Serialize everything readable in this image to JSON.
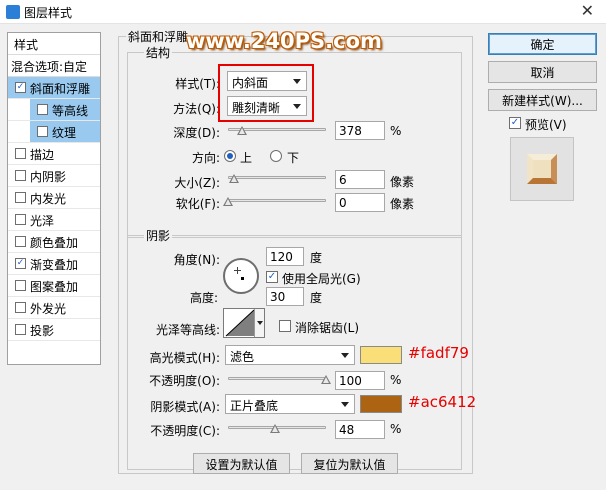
{
  "window": {
    "title": "图层样式",
    "close_glyph": "✕"
  },
  "style_list": {
    "header": "样式",
    "blend_options": "混合选项:自定",
    "items": [
      {
        "label": "斜面和浮雕",
        "checked": true,
        "selected": true,
        "sub": false
      },
      {
        "label": "等高线",
        "checked": false,
        "selected": true,
        "sub": true
      },
      {
        "label": "纹理",
        "checked": false,
        "selected": true,
        "sub": true
      },
      {
        "label": "描边",
        "checked": false,
        "selected": false,
        "sub": false
      },
      {
        "label": "内阴影",
        "checked": false,
        "selected": false,
        "sub": false
      },
      {
        "label": "内发光",
        "checked": false,
        "selected": false,
        "sub": false
      },
      {
        "label": "光泽",
        "checked": false,
        "selected": false,
        "sub": false
      },
      {
        "label": "颜色叠加",
        "checked": false,
        "selected": false,
        "sub": false
      },
      {
        "label": "渐变叠加",
        "checked": true,
        "selected": false,
        "sub": false
      },
      {
        "label": "图案叠加",
        "checked": false,
        "selected": false,
        "sub": false
      },
      {
        "label": "外发光",
        "checked": false,
        "selected": false,
        "sub": false
      },
      {
        "label": "投影",
        "checked": false,
        "selected": false,
        "sub": false
      }
    ]
  },
  "bevel": {
    "group_title": "斜面和浮雕",
    "structure_title": "结构",
    "style_label": "样式(T):",
    "style_value": "内斜面",
    "technique_label": "方法(Q):",
    "technique_value": "雕刻清晰",
    "depth_label": "深度(D):",
    "depth_value": "378",
    "depth_unit": "%",
    "depth_slider": 0.378,
    "direction_label": "方向:",
    "direction_up": "上",
    "direction_down": "下",
    "direction_selected": "up",
    "size_label": "大小(Z):",
    "size_value": "6",
    "size_unit": "像素",
    "size_slider": 0.06,
    "soften_label": "软化(F):",
    "soften_value": "0",
    "soften_unit": "像素",
    "soften_slider": 0
  },
  "shading": {
    "title": "阴影",
    "angle_label": "角度(N):",
    "angle_value": "120",
    "angle_unit": "度",
    "global_light_label": "使用全局光(G)",
    "global_light_checked": true,
    "altitude_label": "高度:",
    "altitude_value": "30",
    "altitude_unit": "度",
    "gloss_contour_label": "光泽等高线:",
    "anti_alias_label": "消除锯齿(L)",
    "anti_alias_checked": false,
    "highlight_mode_label": "高光模式(H):",
    "highlight_mode_value": "滤色",
    "highlight_color": "#fadf79",
    "highlight_color_text": "#fadf79",
    "highlight_opacity_label": "不透明度(O):",
    "highlight_opacity_value": "100",
    "highlight_opacity_unit": "%",
    "highlight_opacity_slider": 1.0,
    "shadow_mode_label": "阴影模式(A):",
    "shadow_mode_value": "正片叠底",
    "shadow_color": "#ac6412",
    "shadow_color_text": "#ac6412",
    "shadow_opacity_label": "不透明度(C):",
    "shadow_opacity_value": "48",
    "shadow_opacity_unit": "%",
    "shadow_opacity_slider": 0.48
  },
  "footer": {
    "make_default": "设置为默认值",
    "reset_default": "复位为默认值"
  },
  "right_panel": {
    "ok": "确定",
    "cancel": "取消",
    "new_style": "新建样式(W)...",
    "preview_label": "预览(V)",
    "preview_checked": true
  },
  "watermark": "www.240PS.com",
  "colors": {
    "selected_row": "#99c9ef",
    "highlight_red": "#e60000",
    "accent_blue": "#1f5fbf"
  }
}
